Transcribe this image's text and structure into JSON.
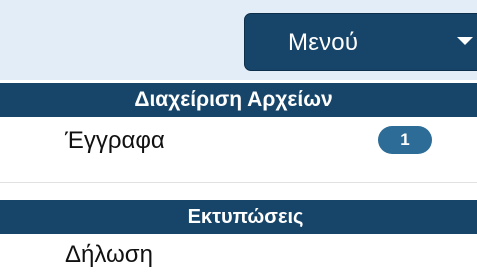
{
  "menu": {
    "label": "Μενού",
    "caret_icon": "chevron-down-icon"
  },
  "sections": [
    {
      "title": "Διαχείριση Αρχείων",
      "items": [
        {
          "label": "Έγγραφα",
          "badge": "1"
        }
      ]
    },
    {
      "title": "Εκτυπώσεις",
      "items": [
        {
          "label": "Δήλωση"
        }
      ]
    }
  ],
  "colors": {
    "primary": "#17456a",
    "badge": "#2c6c96",
    "topbar": "#e3edf8"
  }
}
